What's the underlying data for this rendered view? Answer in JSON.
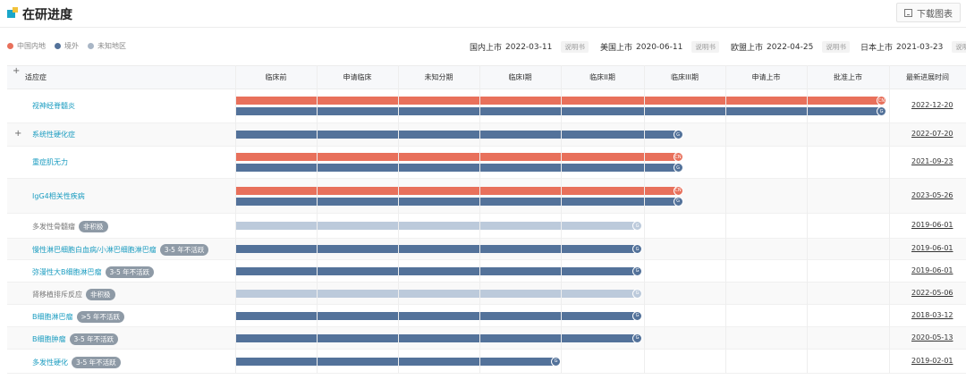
{
  "header": {
    "title": "在研进度",
    "download_label": "下载图表"
  },
  "legend": [
    {
      "label": "中国内地",
      "color": "#e8705b"
    },
    {
      "label": "境外",
      "color": "#53729a"
    },
    {
      "label": "未知地区",
      "color": "#a9b6c6"
    }
  ],
  "markets": [
    {
      "label": "国内上市",
      "date": "2022-03-11",
      "tag": "说明书"
    },
    {
      "label": "美国上市",
      "date": "2020-06-11",
      "tag": "说明书"
    },
    {
      "label": "欧盟上市",
      "date": "2022-04-25",
      "tag": "说明书"
    },
    {
      "label": "日本上市",
      "date": "2021-03-23",
      "tag": "说明书"
    }
  ],
  "table": {
    "plus": "+",
    "columns": [
      "适应症",
      "临床前",
      "申请临床",
      "未知分期",
      "临床I期",
      "临床II期",
      "临床III期",
      "申请上市",
      "批准上市",
      "最新进展时间"
    ],
    "rows": [
      {
        "name": "视神经脊髓炎",
        "badge": "",
        "date": "2022-12-20",
        "bars": [
          {
            "region": "cn",
            "stage": 8,
            "end": "CN"
          },
          {
            "region": "global",
            "stage": 8,
            "end": "G"
          }
        ]
      },
      {
        "name": "系统性硬化症",
        "badge": "",
        "plus": "+",
        "date": "2022-07-20",
        "bars": [
          {
            "region": "global",
            "stage": 5.5,
            "end": "G"
          }
        ]
      },
      {
        "name": "重症肌无力",
        "badge": "",
        "date": "2021-09-23",
        "bars": [
          {
            "region": "cn",
            "stage": 5.5,
            "end": "CN"
          },
          {
            "region": "global",
            "stage": 5.5,
            "end": "G"
          }
        ]
      },
      {
        "name": "IgG4相关性疾病",
        "badge": "",
        "date": "2023-05-26",
        "bars": [
          {
            "region": "cn",
            "stage": 5.5,
            "end": "CN"
          },
          {
            "region": "global",
            "stage": 5.5,
            "end": "G"
          }
        ]
      },
      {
        "name": "多发性骨髓瘤",
        "badge": "非积极",
        "grey": true,
        "date": "2019-06-01",
        "bars": [
          {
            "region": "unknown",
            "stage": 5,
            "end": "G"
          }
        ]
      },
      {
        "name": "慢性淋巴细胞白血病/小淋巴细胞淋巴瘤",
        "badge": "3-5 年不活跃",
        "date": "2019-06-01",
        "bars": [
          {
            "region": "global",
            "stage": 5,
            "end": "G"
          }
        ]
      },
      {
        "name": "弥漫性大B细胞淋巴瘤",
        "badge": "3-5 年不活跃",
        "date": "2019-06-01",
        "bars": [
          {
            "region": "global",
            "stage": 5,
            "end": "G"
          }
        ]
      },
      {
        "name": "肾移植排斥反应",
        "badge": "非积极",
        "grey": true,
        "date": "2022-05-06",
        "bars": [
          {
            "region": "unknown",
            "stage": 5,
            "end": "G"
          }
        ]
      },
      {
        "name": "B细胞淋巴瘤",
        "badge": ">5 年不活跃",
        "date": "2018-03-12",
        "bars": [
          {
            "region": "global",
            "stage": 5,
            "end": "G"
          }
        ]
      },
      {
        "name": "B细胞肿瘤",
        "badge": "3-5 年不活跃",
        "date": "2020-05-13",
        "bars": [
          {
            "region": "global",
            "stage": 5,
            "end": "G"
          }
        ]
      },
      {
        "name": "多发性硬化",
        "badge": "3-5 年不活跃",
        "date": "2019-02-01",
        "bars": [
          {
            "region": "global",
            "stage": 4,
            "end": "G"
          }
        ]
      }
    ]
  },
  "colors": {
    "cn": "#e8705b",
    "global": "#53729a",
    "unknown": "#bccadb"
  }
}
